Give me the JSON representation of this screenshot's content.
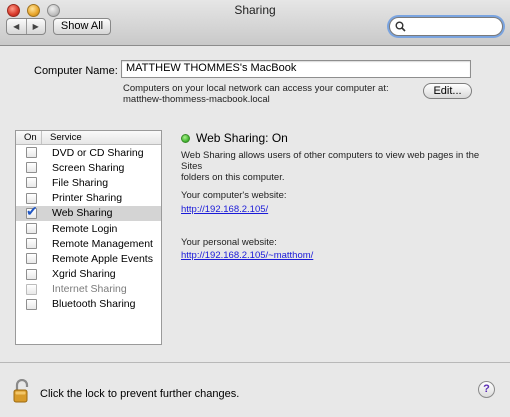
{
  "window": {
    "title": "Sharing"
  },
  "toolbar": {
    "back_icon": "◀",
    "forward_icon": "▶",
    "show_all_label": "Show All",
    "search_placeholder": ""
  },
  "computer": {
    "label": "Computer Name:",
    "name": "MATTHEW THOMMES's MacBook",
    "note_line1": "Computers on your local network can access your computer at:",
    "note_line2": "matthew-thommess-macbook.local",
    "edit_label": "Edit..."
  },
  "services": {
    "header_on": "On",
    "header_service": "Service",
    "items": [
      {
        "label": "DVD or CD Sharing",
        "checked": false,
        "selected": false,
        "enabled": true
      },
      {
        "label": "Screen Sharing",
        "checked": false,
        "selected": false,
        "enabled": true
      },
      {
        "label": "File Sharing",
        "checked": false,
        "selected": false,
        "enabled": true
      },
      {
        "label": "Printer Sharing",
        "checked": false,
        "selected": false,
        "enabled": true
      },
      {
        "label": "Web Sharing",
        "checked": true,
        "selected": true,
        "enabled": true
      },
      {
        "label": "Remote Login",
        "checked": false,
        "selected": false,
        "enabled": true
      },
      {
        "label": "Remote Management",
        "checked": false,
        "selected": false,
        "enabled": true
      },
      {
        "label": "Remote Apple Events",
        "checked": false,
        "selected": false,
        "enabled": true
      },
      {
        "label": "Xgrid Sharing",
        "checked": false,
        "selected": false,
        "enabled": true
      },
      {
        "label": "Internet Sharing",
        "checked": false,
        "selected": false,
        "enabled": false
      },
      {
        "label": "Bluetooth Sharing",
        "checked": false,
        "selected": false,
        "enabled": true
      }
    ]
  },
  "detail": {
    "status": "Web Sharing: On",
    "status_color": "#3bb02a",
    "description_line1": "Web Sharing allows users of other computers to view web pages in the Sites",
    "description_line2": "folders on this computer.",
    "website_label": "Your computer's website:",
    "website_url": "http://192.168.2.105/",
    "personal_label": "Your personal website:",
    "personal_url": "http://192.168.2.105/~matthom/"
  },
  "footer": {
    "lock_text": "Click the lock to prevent further changes.",
    "help_label": "?"
  }
}
